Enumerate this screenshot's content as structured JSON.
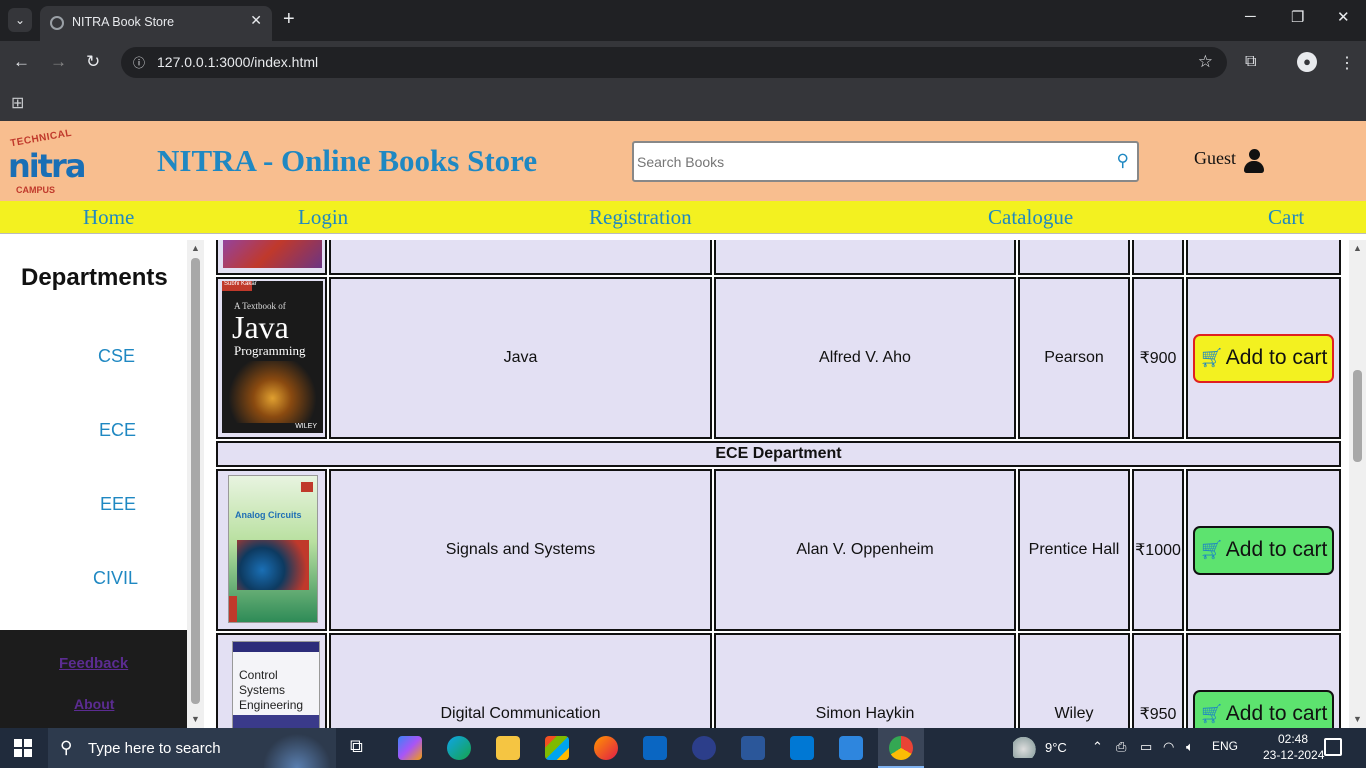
{
  "browser": {
    "tab_title": "NITRA Book Store",
    "url": "127.0.0.1:3000/index.html",
    "new_tab_symbol": "+"
  },
  "header": {
    "logo_top": "TECHNICAL",
    "logo_main": "nitra",
    "logo_bottom": "CAMPUS",
    "title": "NITRA - Online Books Store",
    "search_placeholder": "Search Books",
    "user_label": "Guest"
  },
  "nav": {
    "items": [
      {
        "label": "Home"
      },
      {
        "label": "Login"
      },
      {
        "label": "Registration"
      },
      {
        "label": "Catalogue"
      },
      {
        "label": "Cart"
      }
    ]
  },
  "sidebar": {
    "heading": "Departments",
    "departments": [
      "CSE",
      "ECE",
      "EEE",
      "CIVIL"
    ],
    "footer_links": [
      "Feedback",
      "About"
    ]
  },
  "catalogue": {
    "cse_row": {
      "title": "Java",
      "author": "Alfred V. Aho",
      "publisher": "Pearson",
      "price": "₹900",
      "button": "Add to cart",
      "cover_lines": [
        "Subhi Kakar",
        "A Textbook of",
        "Java",
        "Programming",
        "WILEY"
      ]
    },
    "ece_header": "ECE Department",
    "ece_rows": [
      {
        "title": "Signals and Systems",
        "author": "Alan V. Oppenheim",
        "publisher": "Prentice Hall",
        "price": "₹1000",
        "button": "Add to cart",
        "cover_lines": [
          "Analog Circuits"
        ]
      },
      {
        "title": "Digital Communication",
        "author": "Simon Haykin",
        "publisher": "Wiley",
        "price": "₹950",
        "button": "Add to cart",
        "cover_lines": [
          "Control",
          "Systems",
          "Engineering"
        ]
      }
    ]
  },
  "taskbar": {
    "search_placeholder": "Type here to search",
    "temperature": "9°C",
    "language": "ENG",
    "time": "02:48",
    "date": "23-12-2024"
  },
  "colors": {
    "header_bg": "#f8be8f",
    "nav_bg": "#f3f120",
    "link": "#1f88c2",
    "cell_bg": "#e3e0f3",
    "btn_yellow": "#f3f120",
    "btn_green": "#5de36f"
  }
}
